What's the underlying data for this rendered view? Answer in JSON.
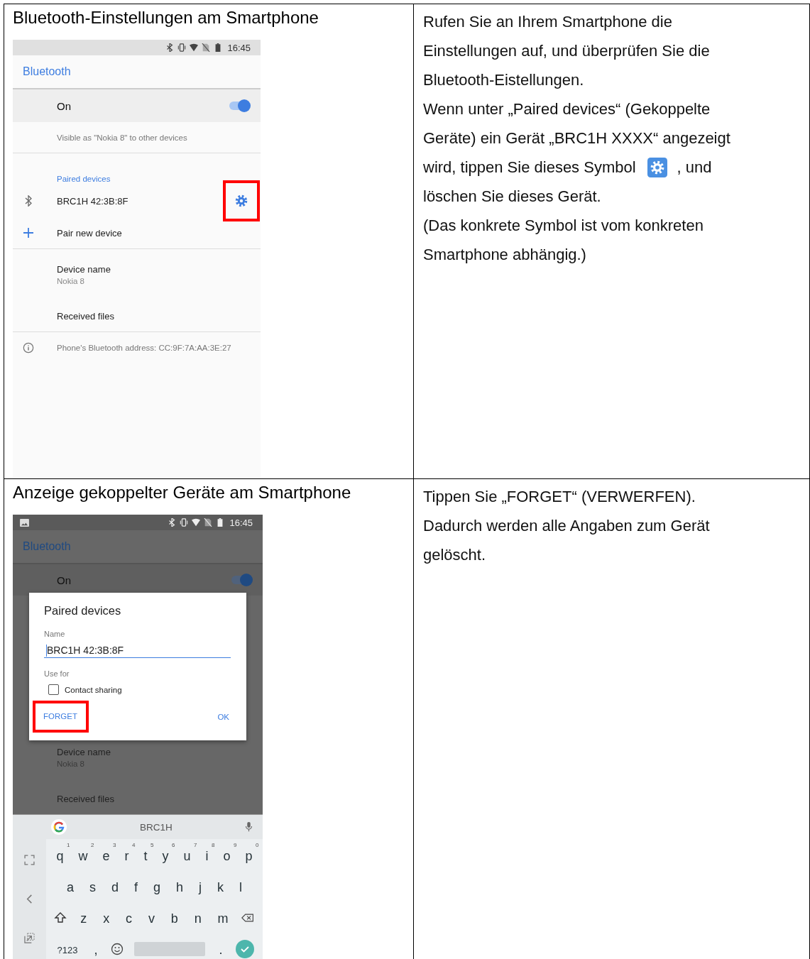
{
  "rows": [
    {
      "caption": "Bluetooth-Einstellungen am Smartphone",
      "screen": {
        "kind": "settings",
        "time": "16:45",
        "title": "Bluetooth",
        "toggle": {
          "label": "On",
          "on": true
        },
        "visible_note": "Visible as \"Nokia 8\" to other devices",
        "section": "Paired devices",
        "paired_device": {
          "name": "BRC1H 42:3B:8F",
          "highlighted": true
        },
        "pair_new": "Pair new device",
        "device_name": {
          "label": "Device name",
          "value": "Nokia 8"
        },
        "received_files": "Received files",
        "address": "Phone's Bluetooth address: CC:9F:7A:AA:3E:27"
      },
      "lines": [
        {
          "kind": "text",
          "text": "Rufen Sie an Ihrem Smartphone die"
        },
        {
          "kind": "text",
          "text": "Einstellungen auf, und überprüfen Sie die"
        },
        {
          "kind": "text",
          "text": "Bluetooth-Eistellungen."
        },
        {
          "kind": "text",
          "text": "Wenn unter „Paired devices“ (Gekoppelte"
        },
        {
          "kind": "text",
          "text": "Geräte) ein Gerät „BRC1H XXXX“ angezeigt"
        },
        {
          "kind": "with_icon",
          "text": "wird, tippen Sie dieses Symbol",
          "text_after": ", und"
        },
        {
          "kind": "text",
          "text": "löschen Sie dieses Gerät."
        },
        {
          "kind": "text",
          "text": "(Das konkrete Symbol ist vom konkreten"
        },
        {
          "kind": "text",
          "text": "Smartphone abhängig.)"
        }
      ]
    },
    {
      "caption": "Anzeige gekoppelter Geräte am Smartphone",
      "screen": {
        "kind": "dialog",
        "time": "16:45",
        "title": "Bluetooth",
        "toggle": {
          "label": "On",
          "on": true
        },
        "device_name": {
          "label": "Device name",
          "value": "Nokia 8"
        },
        "received_files": "Received files",
        "dialog": {
          "title": "Paired devices",
          "name_label": "Name",
          "name_value": "BRC1H 42:3B:8F",
          "use_for": "Use for",
          "contact_sharing": {
            "label": "Contact sharing",
            "checked": false
          },
          "forget": {
            "label": "FORGET",
            "highlighted": true
          },
          "ok": "OK"
        },
        "keyboard": {
          "suggestion": "BRC1H",
          "row1": [
            {
              "key": "q",
              "hint": "1"
            },
            {
              "key": "w",
              "hint": "2"
            },
            {
              "key": "e",
              "hint": "3"
            },
            {
              "key": "r",
              "hint": "4"
            },
            {
              "key": "t",
              "hint": "5"
            },
            {
              "key": "y",
              "hint": "6"
            },
            {
              "key": "u",
              "hint": "7"
            },
            {
              "key": "i",
              "hint": "8"
            },
            {
              "key": "o",
              "hint": "9"
            },
            {
              "key": "p",
              "hint": "0"
            }
          ],
          "row2": [
            "a",
            "s",
            "d",
            "f",
            "g",
            "h",
            "j",
            "k",
            "l"
          ],
          "row3": [
            "z",
            "x",
            "c",
            "v",
            "b",
            "n",
            "m"
          ],
          "symbols": "?123",
          "comma": ",",
          "period": "."
        }
      },
      "lines": [
        {
          "kind": "text",
          "text": "Tippen Sie „FORGET“ (VERWERFEN)."
        },
        {
          "kind": "text",
          "text": "Dadurch werden alle Angaben zum Gerät"
        },
        {
          "kind": "text",
          "text": "gelöscht."
        }
      ]
    }
  ]
}
